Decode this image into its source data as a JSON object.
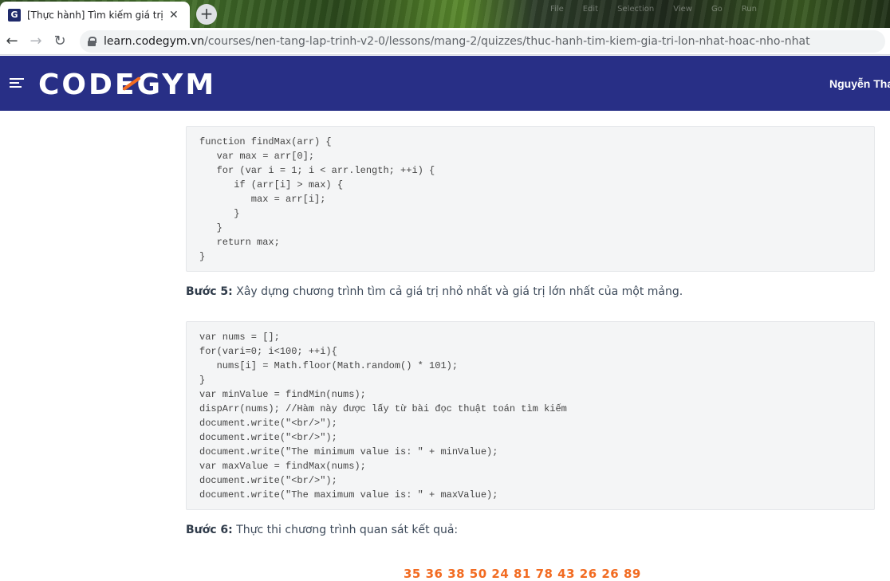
{
  "browser": {
    "tab_title": "[Thực hành] Tìm kiếm giá trị lớn nhất hoặc nhỏ nhất",
    "tab_favicon_letter": "G",
    "tab_close": "✕",
    "new_tab": "+",
    "url_host": "learn.codegym.vn",
    "url_path": "/courses/nen-tang-lap-trinh-v2-0/lessons/mang-2/quizzes/thuc-hanh-tim-kiem-gia-tri-lon-nhat-hoac-nho-nhat",
    "background_window_menu": [
      "File",
      "Edit",
      "Selection",
      "View",
      "Go",
      "Run"
    ]
  },
  "header": {
    "logo": "CODEGYM",
    "user_name": "Nguyễn Than",
    "background": "#282f86",
    "accent": "#f26b21"
  },
  "content": {
    "code_find_max": [
      "function findMax(arr) {",
      "   var max = arr[0];",
      "   for (var i = 1; i < arr.length; ++i) {",
      "      if (arr[i] > max) {",
      "         max = arr[i];",
      "      }",
      "   }",
      "   return max;",
      "}"
    ],
    "step5_label": "Bước 5:",
    "step5_text": " Xây dựng chương trình tìm cả giá trị nhỏ nhất và giá trị lớn nhất của một mảng.",
    "code_main": [
      "var nums = [];",
      "for(vari=0; i<100; ++i){",
      "   nums[i] = Math.floor(Math.random() * 101);",
      "}",
      "var minValue = findMin(nums);",
      "dispArr(nums); //Hàm này được lấy từ bài đọc thuật toán tìm kiếm",
      "document.write(\"<br/>\");",
      "document.write(\"<br/>\");",
      "document.write(\"The minimum value is: \" + minValue);",
      "var maxValue = findMax(nums);",
      "document.write(\"<br/>\");",
      "document.write(\"The maximum value is: \" + maxValue);"
    ],
    "step6_label": "Bước 6:",
    "step6_text": " Thực thi chương trình quan sát kết quả:",
    "result_numbers": "35 36 38 50 24 81 78 43 26 26 89"
  }
}
